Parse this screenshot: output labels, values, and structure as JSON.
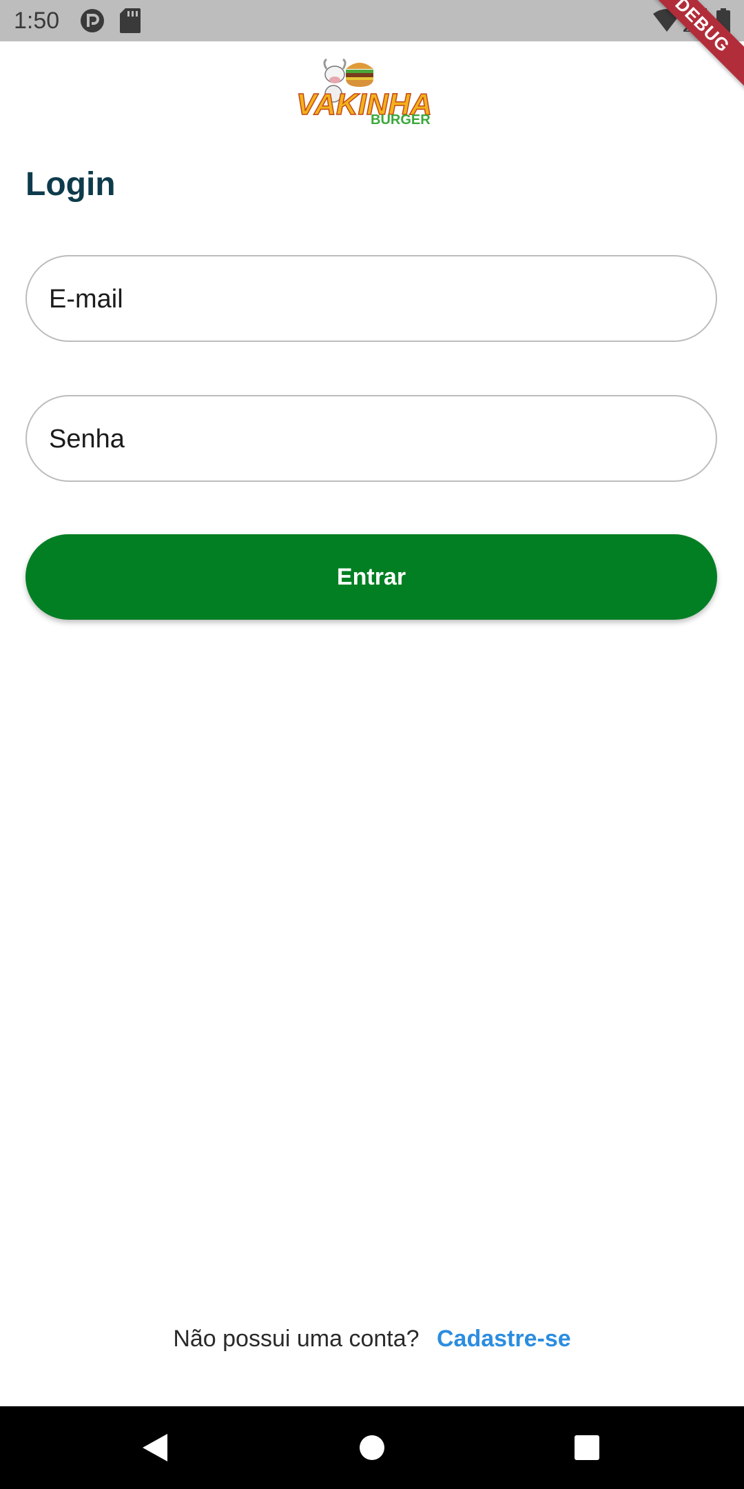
{
  "status_bar": {
    "time": "1:50",
    "icons": [
      "pocket-casts-icon",
      "sd-card-icon",
      "wifi-icon",
      "signal-icon",
      "battery-icon"
    ]
  },
  "debug_banner": "DEBUG",
  "logo": {
    "main": "VAKINHA",
    "sub": "BURGER"
  },
  "login": {
    "title": "Login",
    "email_placeholder": "E-mail",
    "password_placeholder": "Senha",
    "submit_label": "Entrar"
  },
  "signup": {
    "prompt": "Não possui uma conta?",
    "link": "Cadastre-se"
  },
  "colors": {
    "primary": "#027F23",
    "title": "#0D3B4C",
    "link": "#2B8DE0",
    "debug": "#B22D3A"
  },
  "nav": {
    "icons": [
      "back-icon",
      "home-icon",
      "recents-icon"
    ]
  }
}
